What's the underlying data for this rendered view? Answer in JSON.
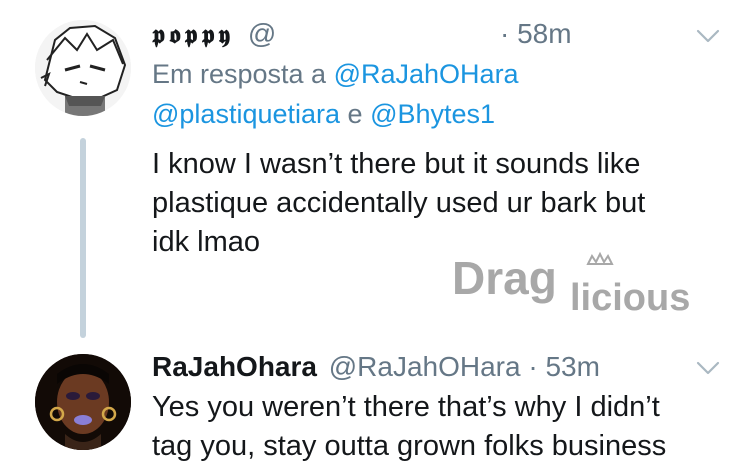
{
  "tweet1": {
    "display_name": "𝖕𝖔𝖕𝖕𝖞",
    "handle": "@",
    "dot": "·",
    "time": "58m",
    "reply_prefix": "Em resposta a",
    "reply_mention_1": "@RaJahOHara",
    "reply_mention_2": "@plastiquetiara",
    "reply_conj": "e",
    "reply_mention_3": "@Bhytes1",
    "text_line_1": "I know I wasn’t there but it sounds like",
    "text_line_2": "plastique accidentally used ur bark but",
    "text_line_3": "idk lmao"
  },
  "tweet2": {
    "display_name": "RaJahOhara",
    "handle": "@RaJahOHara",
    "dot": "·",
    "time": "53m",
    "text_line_1": "Yes you weren’t there that’s why I didn’t",
    "text_line_2": "tag you, stay outta grown folks business"
  },
  "watermark": {
    "text_part1": "Drag",
    "text_part2": "licious"
  },
  "colors": {
    "text": "#14171a",
    "secondary": "#657786",
    "link": "#1b95e0",
    "thread_line": "#c4d2dc",
    "watermark": "#a8a8a8"
  },
  "icons": {
    "caret": "chevron-down-icon",
    "crown": "crown-icon"
  }
}
